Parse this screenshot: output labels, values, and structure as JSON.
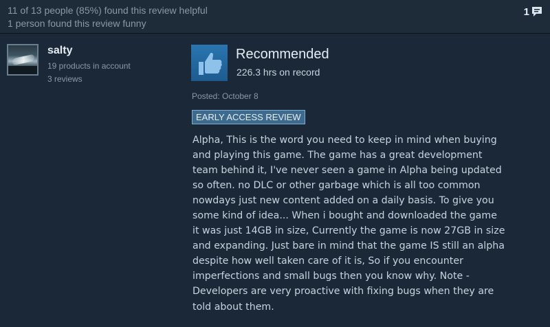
{
  "header": {
    "helpful_text": "11 of 13 people (85%) found this review helpful",
    "funny_text": "1 person found this review funny",
    "comment_count": "1",
    "comment_icon": "speech-bubble-icon"
  },
  "author": {
    "name": "salty",
    "products": "19 products in account",
    "reviews": "3 reviews"
  },
  "review": {
    "verdict": "Recommended",
    "verdict_icon": "thumbs-up-icon",
    "hours": "226.3 hrs on record",
    "posted": "Posted: October 8",
    "badge": "EARLY ACCESS REVIEW",
    "body_lines": [
      "Alpha, This is the word you need to keep in mind when buying",
      "and playing this game. The game has a great development",
      "team behind it, I've never seen a game in Alpha being updated",
      "so often. no DLC or other garbage which is all too common",
      "nowdays just new content added on a daily basis. To give you",
      "some kind of idea... When i bought and downloaded the game",
      "it was just 14GB in size, Currently the game is now 27GB in size",
      "and expanding. Just bare in mind that the game IS still an alpha",
      "despite how well taken care of it is, So if you encounter",
      "imperfections and small bugs then you know why. Note -",
      "Developers are very proactive with fixing bugs when they are",
      "told about them."
    ]
  },
  "colors": {
    "background": "#1b2838",
    "thumb_blue": "#2a75b0",
    "badge_bg": "#3e6a8e",
    "text_primary": "#e6eef5",
    "text_muted": "#8b99a6"
  }
}
